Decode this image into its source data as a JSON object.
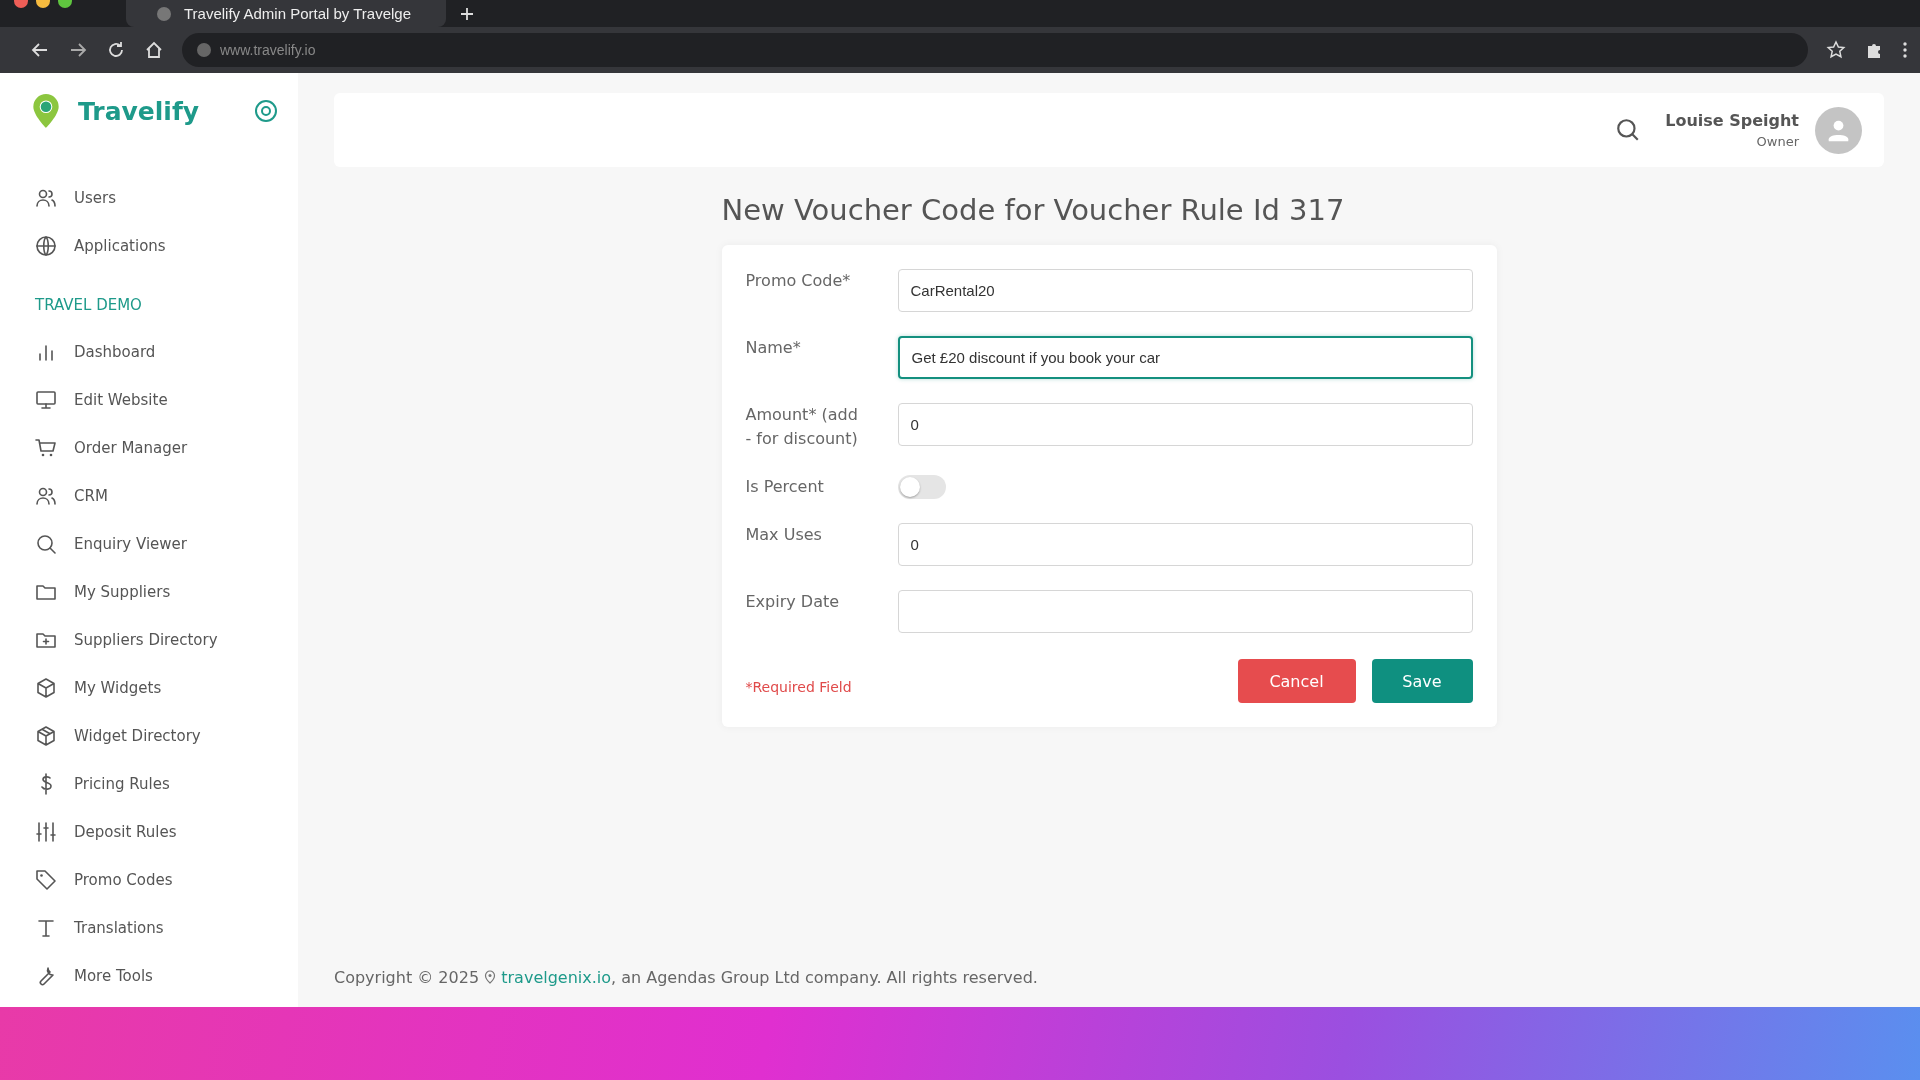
{
  "browser": {
    "tab_title": "Travelify Admin Portal by Travelge",
    "url": "www.travelify.io"
  },
  "sidebar": {
    "brand": "Travelify",
    "items": [
      {
        "label": "Users"
      },
      {
        "label": "Applications"
      }
    ],
    "section": "TRAVEL DEMO",
    "section_items": [
      {
        "label": "Dashboard"
      },
      {
        "label": "Edit Website"
      },
      {
        "label": "Order Manager"
      },
      {
        "label": "CRM"
      },
      {
        "label": "Enquiry Viewer"
      },
      {
        "label": "My Suppliers"
      },
      {
        "label": "Suppliers Directory"
      },
      {
        "label": "My Widgets"
      },
      {
        "label": "Widget Directory"
      },
      {
        "label": "Pricing Rules"
      },
      {
        "label": "Deposit Rules"
      },
      {
        "label": "Promo Codes"
      },
      {
        "label": "Translations"
      },
      {
        "label": "More Tools"
      }
    ]
  },
  "header": {
    "user_name": "Louise Speight",
    "user_role": "Owner"
  },
  "page_title": "New Voucher Code for Voucher Rule Id 317",
  "form": {
    "fields": [
      {
        "kind": "text",
        "label": "Promo Code*",
        "value": "CarRental20",
        "focused": false
      },
      {
        "kind": "text",
        "label": "Name*",
        "value": "Get £20 discount if you book your car",
        "focused": true
      },
      {
        "kind": "text",
        "label": "Amount* (add - for discount)",
        "value": "0",
        "focused": false
      },
      {
        "kind": "toggle",
        "label": "Is Percent",
        "on": false
      },
      {
        "kind": "text",
        "label": "Max Uses",
        "value": "0",
        "focused": false
      },
      {
        "kind": "text",
        "label": "Expiry Date",
        "focused": false
      }
    ],
    "required_note": "*Required Field",
    "buttons": [
      {
        "kind": "cancel",
        "label": "Cancel"
      },
      {
        "kind": "save",
        "label": "Save"
      }
    ]
  },
  "footer": {
    "before": "Copyright © 2025",
    "link": "travelgenix.io",
    "after": ", an Agendas Group Ltd company. All rights reserved."
  }
}
